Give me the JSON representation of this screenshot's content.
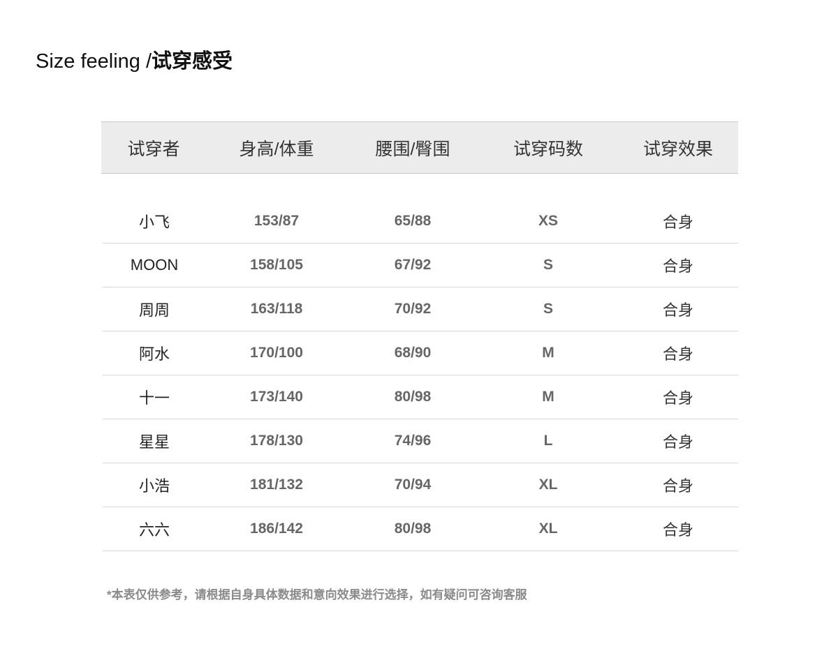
{
  "title": {
    "en": "Size feeling /",
    "cn": "试穿感受"
  },
  "table": {
    "headers": [
      "试穿者",
      "身高/体重",
      "腰围/臀围",
      "试穿码数",
      "试穿效果"
    ],
    "rows": [
      {
        "name": "小飞",
        "height_weight": "153/87",
        "waist_hip": "65/88",
        "size": "XS",
        "fit": "合身"
      },
      {
        "name": "MOON",
        "height_weight": "158/105",
        "waist_hip": "67/92",
        "size": "S",
        "fit": "合身"
      },
      {
        "name": "周周",
        "height_weight": "163/118",
        "waist_hip": "70/92",
        "size": "S",
        "fit": "合身"
      },
      {
        "name": "阿水",
        "height_weight": "170/100",
        "waist_hip": "68/90",
        "size": "M",
        "fit": "合身"
      },
      {
        "name": "十一",
        "height_weight": "173/140",
        "waist_hip": "80/98",
        "size": "M",
        "fit": "合身"
      },
      {
        "name": "星星",
        "height_weight": "178/130",
        "waist_hip": "74/96",
        "size": "L",
        "fit": "合身"
      },
      {
        "name": "小浩",
        "height_weight": "181/132",
        "waist_hip": "70/94",
        "size": "XL",
        "fit": "合身"
      },
      {
        "name": "六六",
        "height_weight": "186/142",
        "waist_hip": "80/98",
        "size": "XL",
        "fit": "合身"
      }
    ]
  },
  "footnote": "*本表仅供参考，请根据自身具体数据和意向效果进行选择，如有疑问可咨询客服",
  "colors": {
    "header_background": "#ececec",
    "value_text": "#666666",
    "footnote_text": "#8a8a8a"
  }
}
